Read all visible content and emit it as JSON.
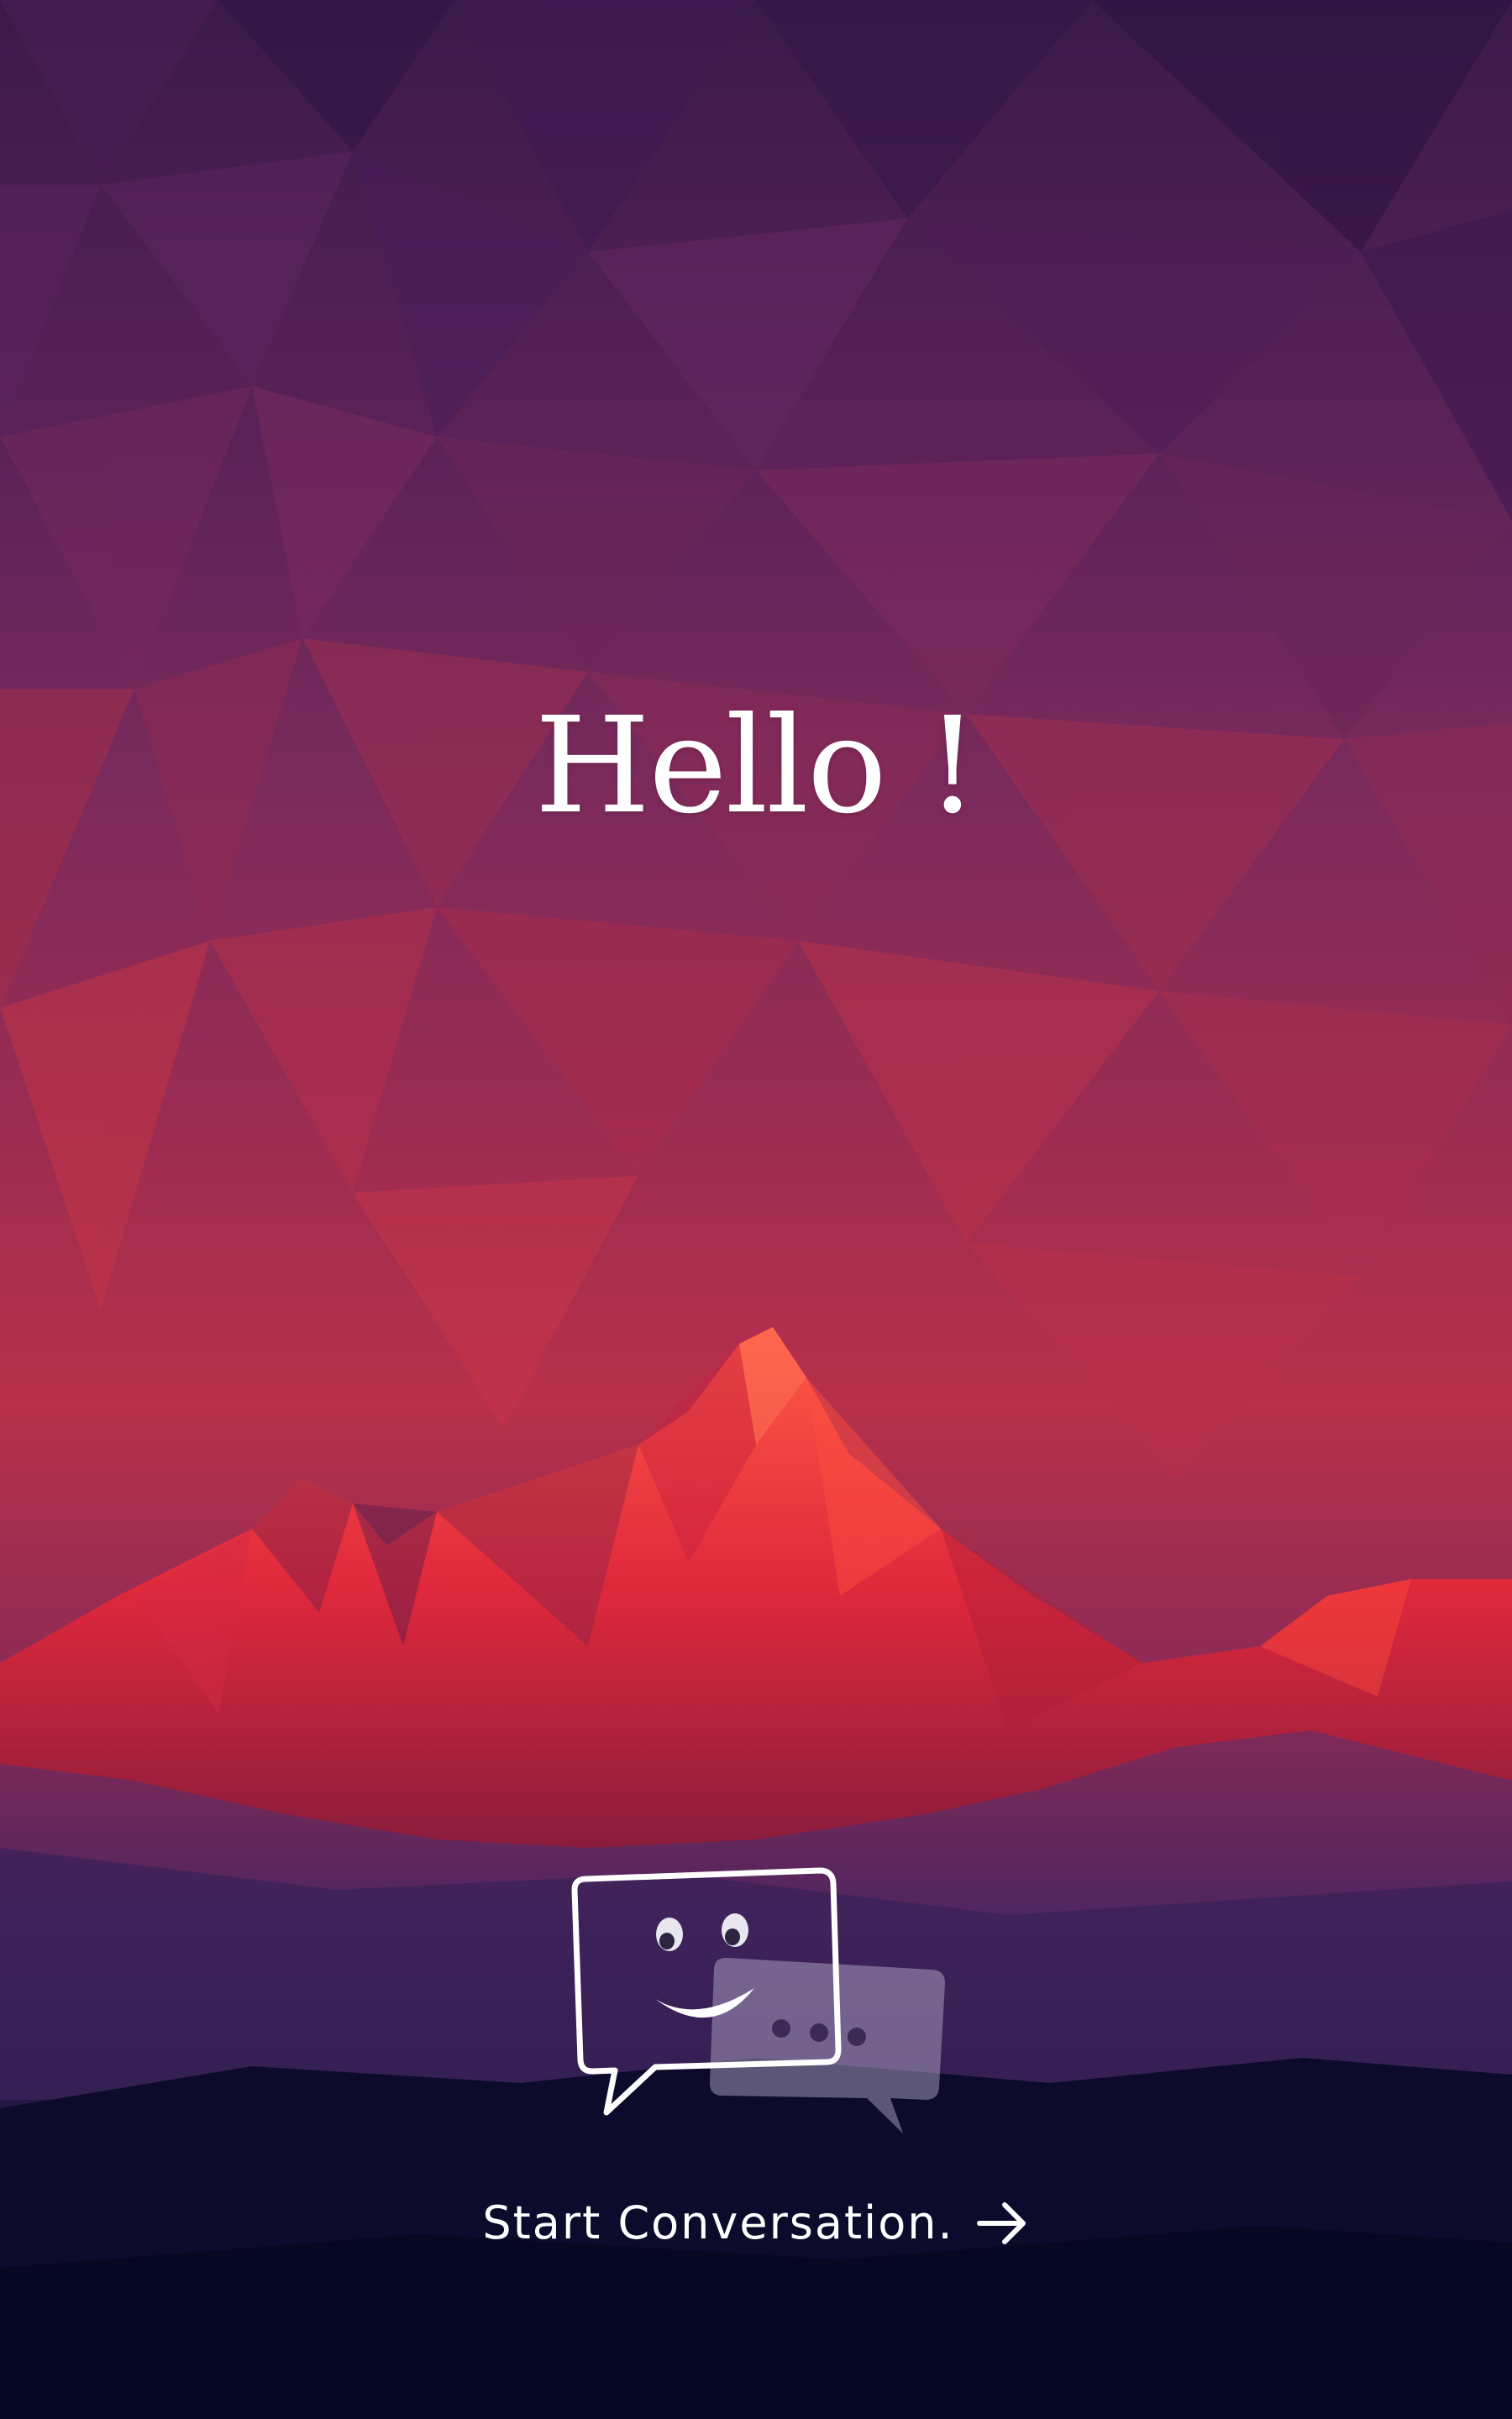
{
  "screen": {
    "greeting": "Hello !",
    "cta_label": "Start Conversation.",
    "cta_icon": "arrow-right-icon",
    "logo_icon": "chat-bubbles-smiley-icon"
  },
  "colors": {
    "sky_top": "#3d1a4e",
    "sky_mid": "#7a2a5a",
    "sky_low": "#b8304a",
    "mountain": "#e8323e",
    "ground": "#0c0a2a",
    "text": "#ffffff"
  }
}
